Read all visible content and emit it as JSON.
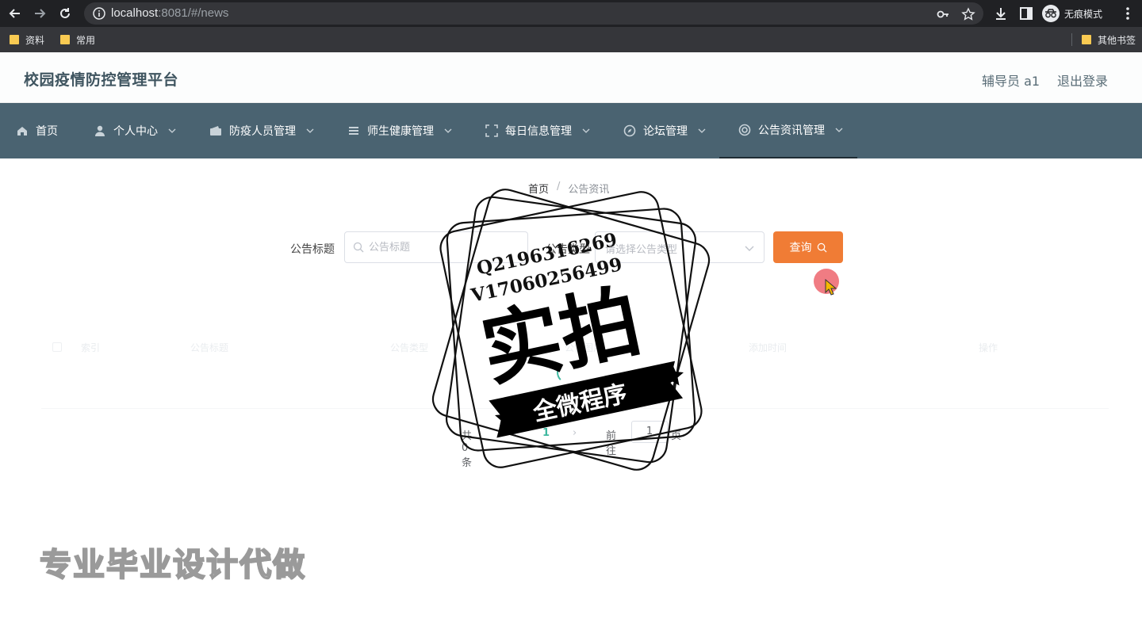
{
  "browser": {
    "url_host": "localhost",
    "url_rest": ":8081/#/news",
    "profile_label": "无痕模式",
    "bookmarks": [
      {
        "label": "资料"
      },
      {
        "label": "常用"
      }
    ],
    "other_bookmarks": "其他书签"
  },
  "app": {
    "title": "校园疫情防控管理平台",
    "user": "辅导员 a1",
    "logout": "退出登录"
  },
  "menu": [
    {
      "label": "首页",
      "icon": "home-icon"
    },
    {
      "label": "个人中心",
      "icon": "person-icon"
    },
    {
      "label": "防疫人员管理",
      "icon": "wallet-icon"
    },
    {
      "label": "师生健康管理",
      "icon": "list-icon"
    },
    {
      "label": "每日信息管理",
      "icon": "frame-icon"
    },
    {
      "label": "论坛管理",
      "icon": "compass-icon"
    },
    {
      "label": "公告资讯管理",
      "icon": "lifebuoy-icon"
    }
  ],
  "breadcrumb": {
    "home": "首页",
    "separator": "/",
    "current": "公告资讯"
  },
  "search": {
    "title_label": "公告标题",
    "title_placeholder": "公告标题",
    "type_label": "公告类型",
    "type_placeholder": "请选择公告类型",
    "query_button": "查询"
  },
  "table": {
    "columns": [
      "索引",
      "公告标题",
      "公告类型",
      "公告图片",
      "添加时间",
      "操作"
    ]
  },
  "pagination": {
    "total": "共 0 条",
    "current_page": "1",
    "goto_label": "前往",
    "goto_value": "1",
    "page_unit": "页"
  },
  "watermark": {
    "qq": "Q2196316269",
    "wechat": "V17060256499",
    "main": "实拍",
    "banner": "全微程序",
    "bottom": "专业毕业设计代做"
  },
  "colors": {
    "menu_bg": "#4a6371",
    "accent": "#f07c35",
    "page_active": "#3fb8a0"
  }
}
